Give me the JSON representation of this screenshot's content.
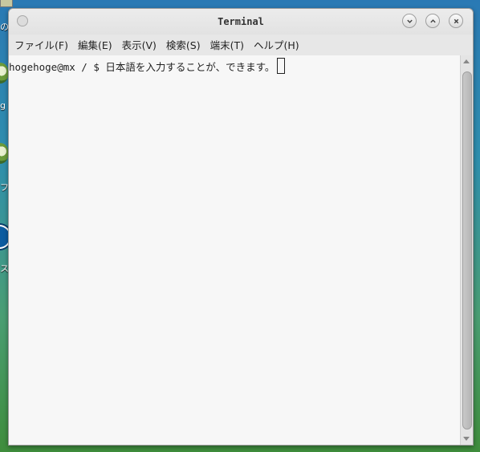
{
  "window": {
    "title": "Terminal"
  },
  "menu": [
    "ファイル(F)",
    "編集(E)",
    "表示(V)",
    "検索(S)",
    "端末(T)",
    "ヘルプ(H)"
  ],
  "terminal": {
    "prompt": "hogehoge@mx / $ ",
    "input": "日本語を入力することが、できます。"
  },
  "desktop": {
    "labels": [
      "の",
      "g",
      "フェ",
      "ス・"
    ]
  }
}
